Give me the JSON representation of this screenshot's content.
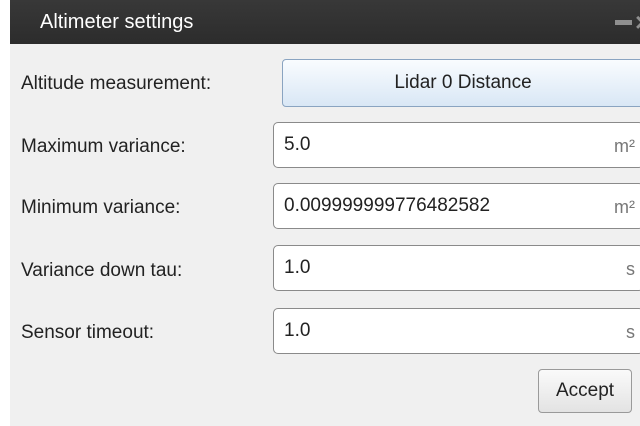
{
  "window": {
    "title": "Altimeter settings",
    "minimize_icon": "minimize-icon",
    "close_icon": "close-icon",
    "close_glyph": "×"
  },
  "altitude": {
    "label": "Altitude measurement:",
    "selected": "Lidar 0 Distance"
  },
  "fields": [
    {
      "label": "Maximum variance:",
      "value": "5.0",
      "unit": "m²"
    },
    {
      "label": "Minimum variance:",
      "value": "0.009999999776482582",
      "unit": "m²"
    },
    {
      "label": "Variance down tau:",
      "value": "1.0",
      "unit": "s"
    },
    {
      "label": "Sensor timeout:",
      "value": "1.0",
      "unit": "s"
    }
  ],
  "actions": {
    "accept_label": "Accept"
  },
  "colors": {
    "titlebar": "#2f2f2f",
    "background": "#f0f0f0",
    "dropdown_accent": "#d9e7f5"
  }
}
